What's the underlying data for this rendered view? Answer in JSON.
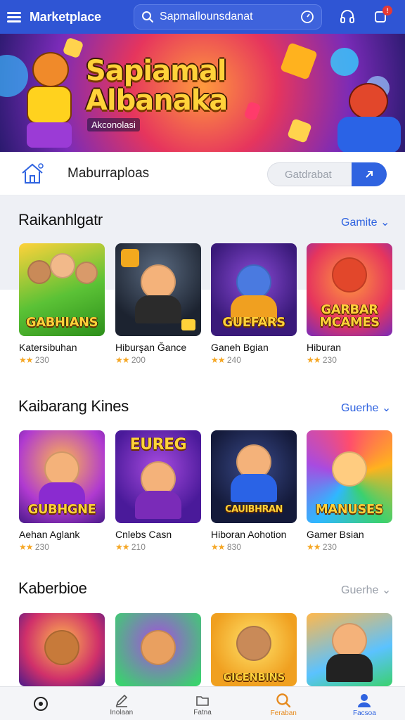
{
  "header": {
    "brand": "Marketplace",
    "search_value": "Sapmallounsdanat"
  },
  "banner": {
    "title_line1": "Sapiamal",
    "title_line2": "Albanaka",
    "subtitle": "Akconolasi"
  },
  "strip": {
    "label": "Maburraploas",
    "input_placeholder": "Gatdrabat"
  },
  "sections": [
    {
      "title": "Raikanhlgatr",
      "more": "Gamite",
      "items": [
        {
          "thumb_text": "GABHIANS",
          "title": "Katersibuhan",
          "rating": "230"
        },
        {
          "thumb_text": "",
          "title": "Hiburşan Ğance",
          "rating": "200"
        },
        {
          "thumb_text": "GUEFARS",
          "title": "Ganeh Bgian",
          "rating": "240"
        },
        {
          "thumb_text": "GARBAR MCAMES",
          "title": "Hiburan",
          "rating": "230"
        }
      ]
    },
    {
      "title": "Kaibarang Kines",
      "more": "Guerhe",
      "items": [
        {
          "thumb_text": "GUBHGNE",
          "title": "Aehan Aglank",
          "rating": "230"
        },
        {
          "thumb_text": "EUREG",
          "title": "Cnlebs Casn",
          "rating": "210"
        },
        {
          "thumb_text": "CAUIBHRAN",
          "title": "Hiboran Aohotion",
          "rating": "830"
        },
        {
          "thumb_text": "MANUSES",
          "title": "Gamer Bsian",
          "rating": "230"
        }
      ]
    },
    {
      "title": "Kaberbioe",
      "more": "Guerhe",
      "items": [
        {
          "thumb_text": "",
          "title": "",
          "rating": ""
        },
        {
          "thumb_text": "",
          "title": "",
          "rating": ""
        },
        {
          "thumb_text": "GICENBINS",
          "title": "",
          "rating": ""
        },
        {
          "thumb_text": "",
          "title": "",
          "rating": ""
        }
      ]
    }
  ],
  "bottom_nav": [
    {
      "label": "",
      "icon": "compass-icon"
    },
    {
      "label": "Inolaan",
      "icon": "pencil-icon"
    },
    {
      "label": "Fatna",
      "icon": "folder-icon"
    },
    {
      "label": "Feraban",
      "icon": "search-icon"
    },
    {
      "label": "Facsoa",
      "icon": "profile-icon"
    }
  ],
  "colors": {
    "header": "#2f55d4",
    "accent": "#2f63e0",
    "rating_star": "#f5a623"
  }
}
